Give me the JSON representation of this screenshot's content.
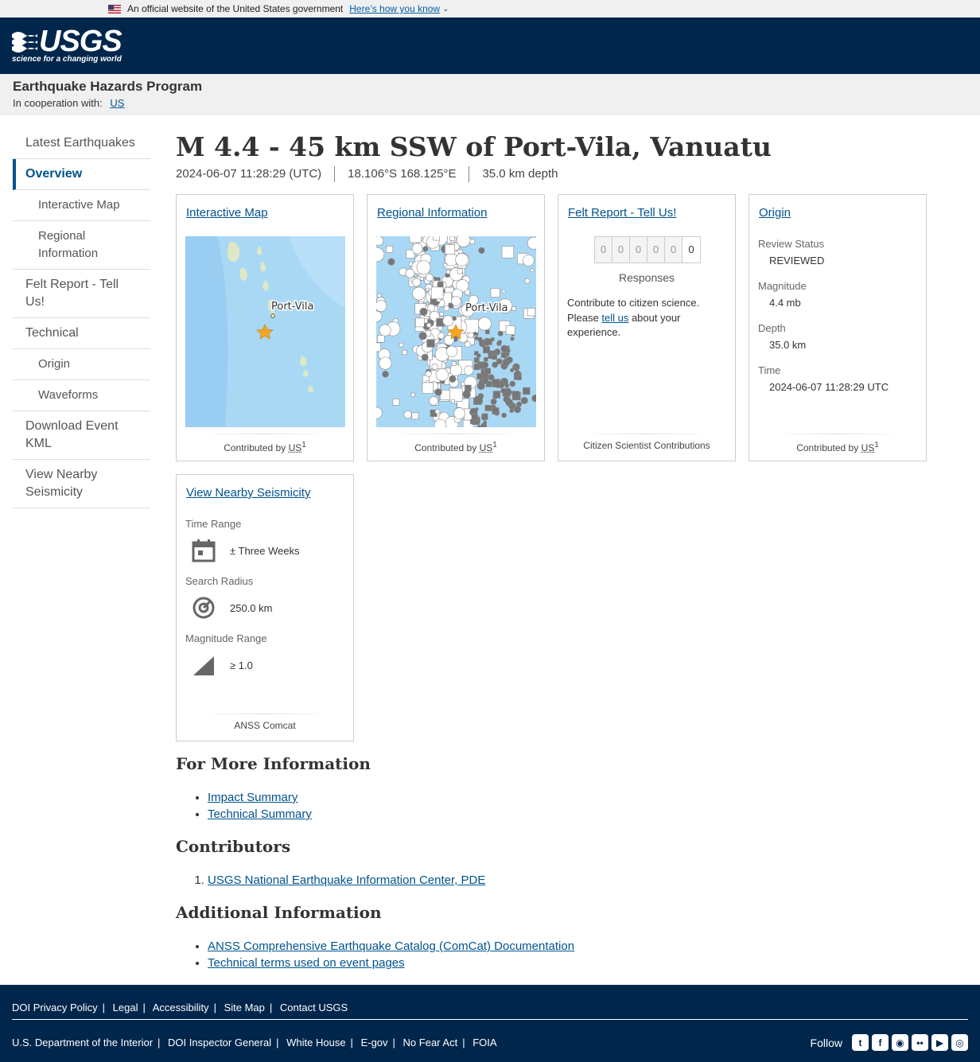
{
  "gov_banner": {
    "text": "An official website of the United States government",
    "link": "Here’s how you know"
  },
  "header": {
    "logo_text": "USGS",
    "tagline": "science for a changing world"
  },
  "program": {
    "title": "Earthquake Hazards Program",
    "coop_label": "In cooperation with:",
    "coop_link": "US"
  },
  "sidebar": {
    "items": [
      {
        "label": "Latest Earthquakes"
      },
      {
        "label": "Overview"
      },
      {
        "label": "Interactive Map"
      },
      {
        "label": "Regional Information"
      },
      {
        "label": "Felt Report - Tell Us!"
      },
      {
        "label": "Technical"
      },
      {
        "label": "Origin"
      },
      {
        "label": "Waveforms"
      },
      {
        "label": "Download Event KML"
      },
      {
        "label": "View Nearby Seismicity"
      }
    ]
  },
  "event": {
    "title": "M 4.4 - 45 km SSW of Port-Vila, Vanuatu",
    "time": "2024-06-07 11:28:29 (UTC)",
    "location": "18.106°S 168.125°E",
    "depth": "35.0 km depth"
  },
  "cards": {
    "interactive_map": {
      "link": "Interactive Map",
      "map_label": "Port-Vila",
      "contrib": "Contributed by",
      "contrib_net": "US",
      "contrib_num": "1"
    },
    "regional": {
      "link": "Regional Information",
      "map_label": "Port-Vila",
      "contrib": "Contributed by",
      "contrib_net": "US",
      "contrib_num": "1"
    },
    "felt": {
      "link": "Felt Report - Tell Us!",
      "digits": [
        "0",
        "0",
        "0",
        "0",
        "0",
        "0"
      ],
      "responses": "Responses",
      "text_pre": "Contribute to citizen science. Please ",
      "text_link": "tell us",
      "text_post": " about your experience.",
      "foot": "Citizen Scientist Contributions"
    },
    "origin": {
      "link": "Origin",
      "review_label": "Review Status",
      "review_value": "REVIEWED",
      "mag_label": "Magnitude",
      "mag_value": "4.4 mb",
      "depth_label": "Depth",
      "depth_value": "35.0 km",
      "time_label": "Time",
      "time_value": "2024-06-07 11:28:29 UTC",
      "contrib": "Contributed by",
      "contrib_net": "US",
      "contrib_num": "1"
    },
    "seismicity": {
      "link": "View Nearby Seismicity",
      "time_label": "Time Range",
      "time_value": "± Three Weeks",
      "radius_label": "Search Radius",
      "radius_value": "250.0 km",
      "mag_label": "Magnitude Range",
      "mag_value": "≥ 1.0",
      "foot": "ANSS Comcat"
    }
  },
  "more_info": {
    "heading": "For More Information",
    "links": [
      "Impact Summary",
      "Technical Summary"
    ]
  },
  "contributors": {
    "heading": "Contributors",
    "links": [
      "USGS National Earthquake Information Center, PDE"
    ]
  },
  "additional": {
    "heading": "Additional Information",
    "links": [
      "ANSS Comprehensive Earthquake Catalog (ComCat) Documentation",
      "Technical terms used on event pages"
    ]
  },
  "footer": {
    "row1": [
      "DOI Privacy Policy",
      "Legal",
      "Accessibility",
      "Site Map",
      "Contact USGS"
    ],
    "row2": [
      "U.S. Department of the Interior",
      "DOI Inspector General",
      "White House",
      "E-gov",
      "No Fear Act",
      "FOIA"
    ],
    "follow": "Follow"
  },
  "colors": {
    "header_bg": "#00264c",
    "link": "#00538d",
    "map_water": "#a9d8f5",
    "star": "#f5a623"
  }
}
